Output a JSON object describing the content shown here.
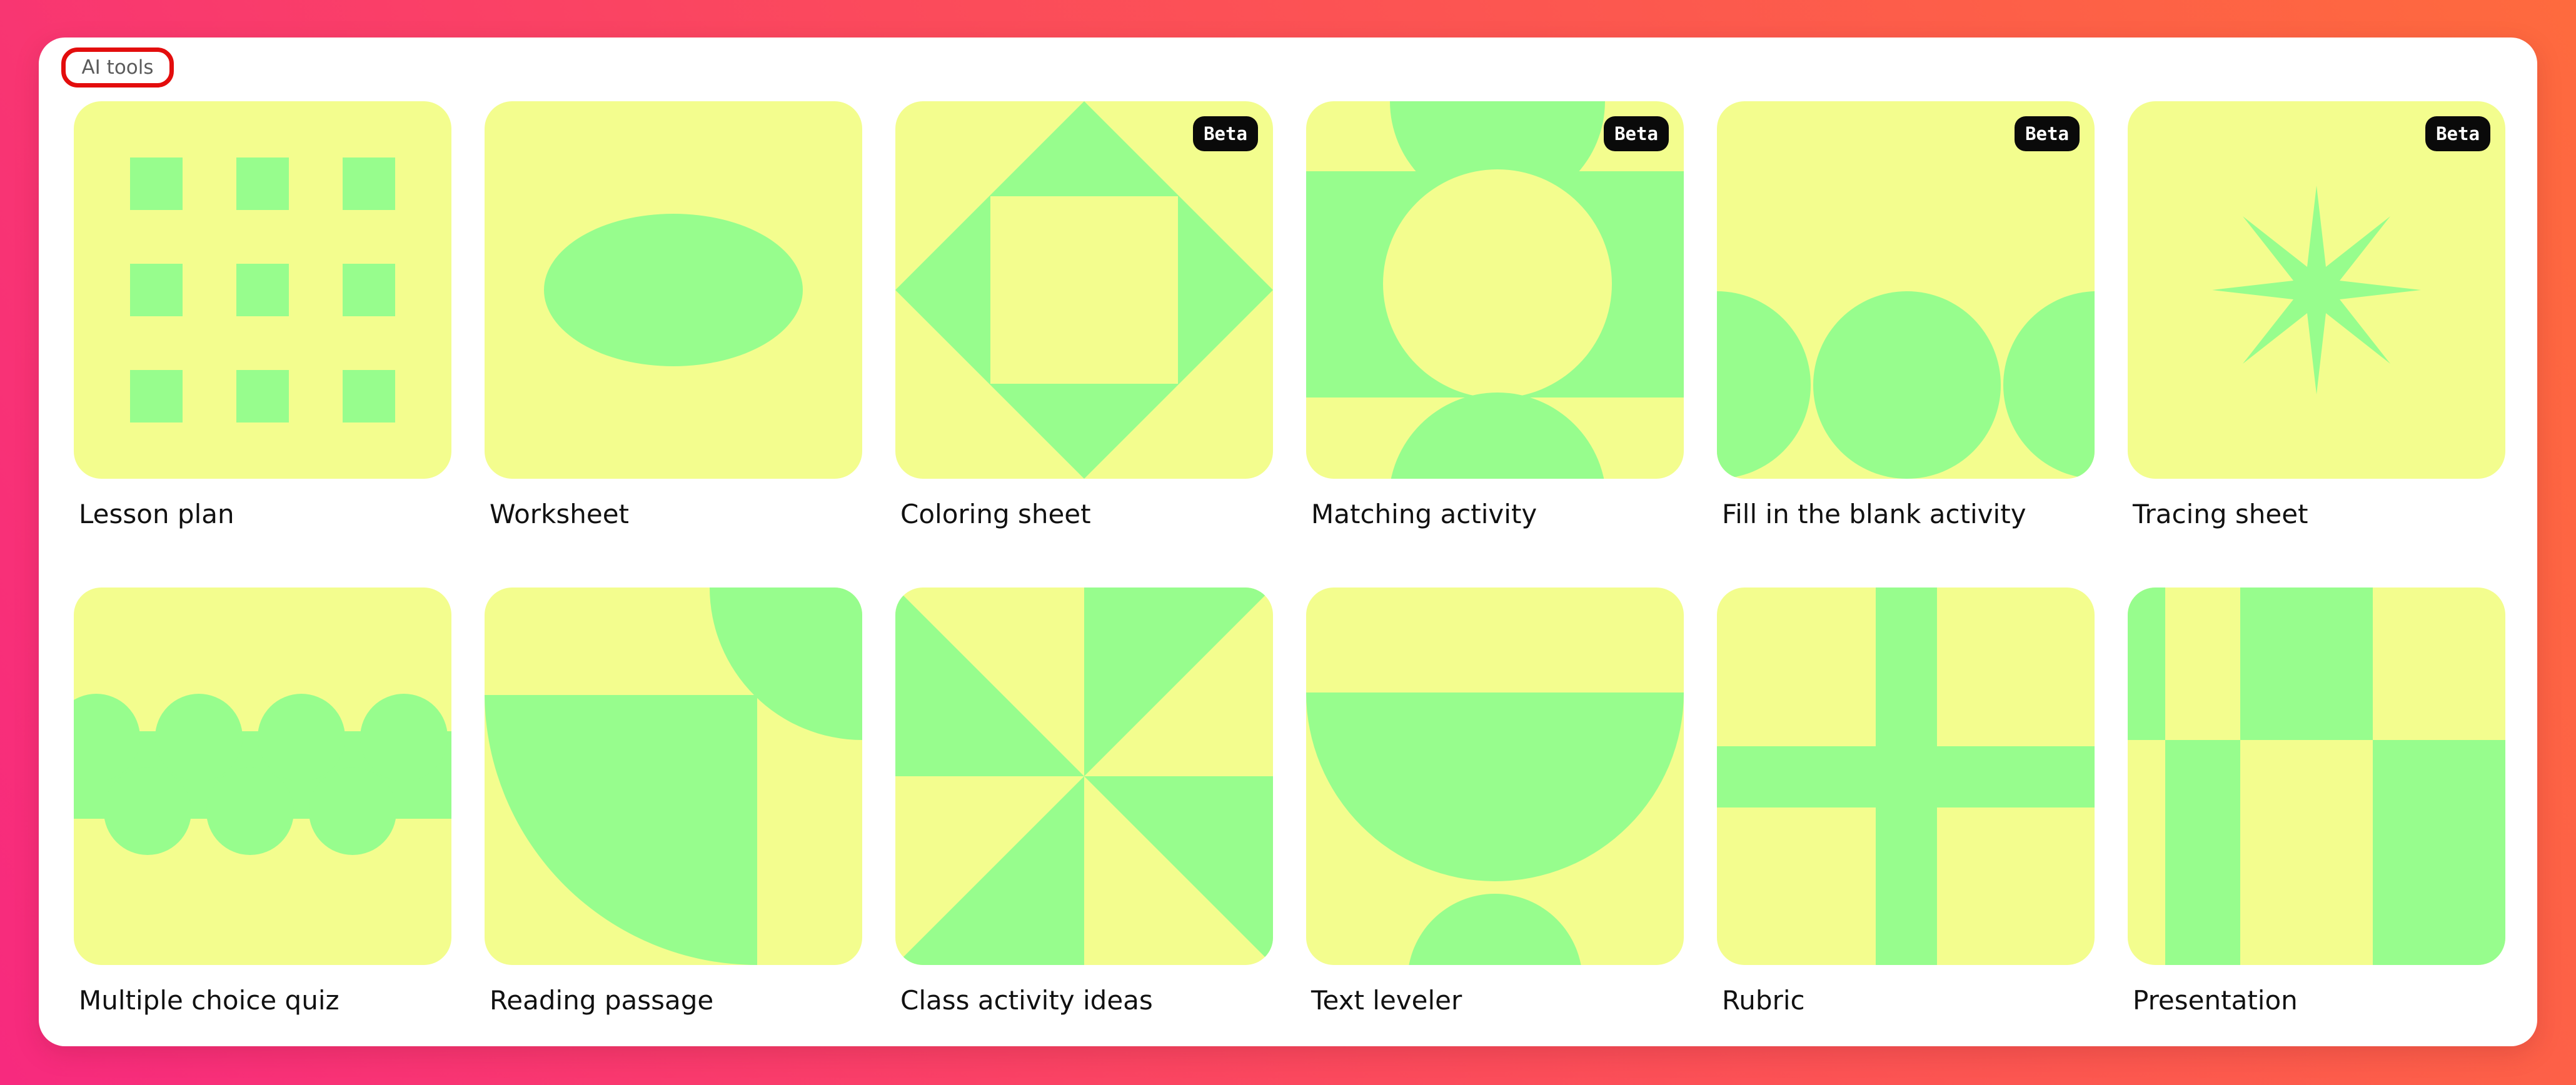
{
  "section": {
    "label": "AI tools"
  },
  "colors": {
    "tile": "#f3fd8e",
    "shape": "#97fd8d",
    "badge": "#0a0a0a"
  },
  "tools": [
    {
      "label": "Lesson plan",
      "beta": "",
      "icon": "grid-squares-icon"
    },
    {
      "label": "Worksheet",
      "beta": "",
      "icon": "ellipse-icon"
    },
    {
      "label": "Coloring sheet",
      "beta": "Beta",
      "icon": "diamond-square-icon"
    },
    {
      "label": "Matching activity",
      "beta": "Beta",
      "icon": "circles-band-icon"
    },
    {
      "label": "Fill in the blank activity",
      "beta": "Beta",
      "icon": "three-circles-icon"
    },
    {
      "label": "Tracing sheet",
      "beta": "Beta",
      "icon": "star-burst-icon"
    },
    {
      "label": "Multiple choice quiz",
      "beta": "",
      "icon": "wave-band-icon"
    },
    {
      "label": "Reading passage",
      "beta": "",
      "icon": "quarter-circles-icon"
    },
    {
      "label": "Class activity ideas",
      "beta": "",
      "icon": "pinwheel-icon"
    },
    {
      "label": "Text leveler",
      "beta": "",
      "icon": "bowl-icon"
    },
    {
      "label": "Rubric",
      "beta": "",
      "icon": "cross-icon"
    },
    {
      "label": "Presentation",
      "beta": "",
      "icon": "checker-icon"
    }
  ]
}
